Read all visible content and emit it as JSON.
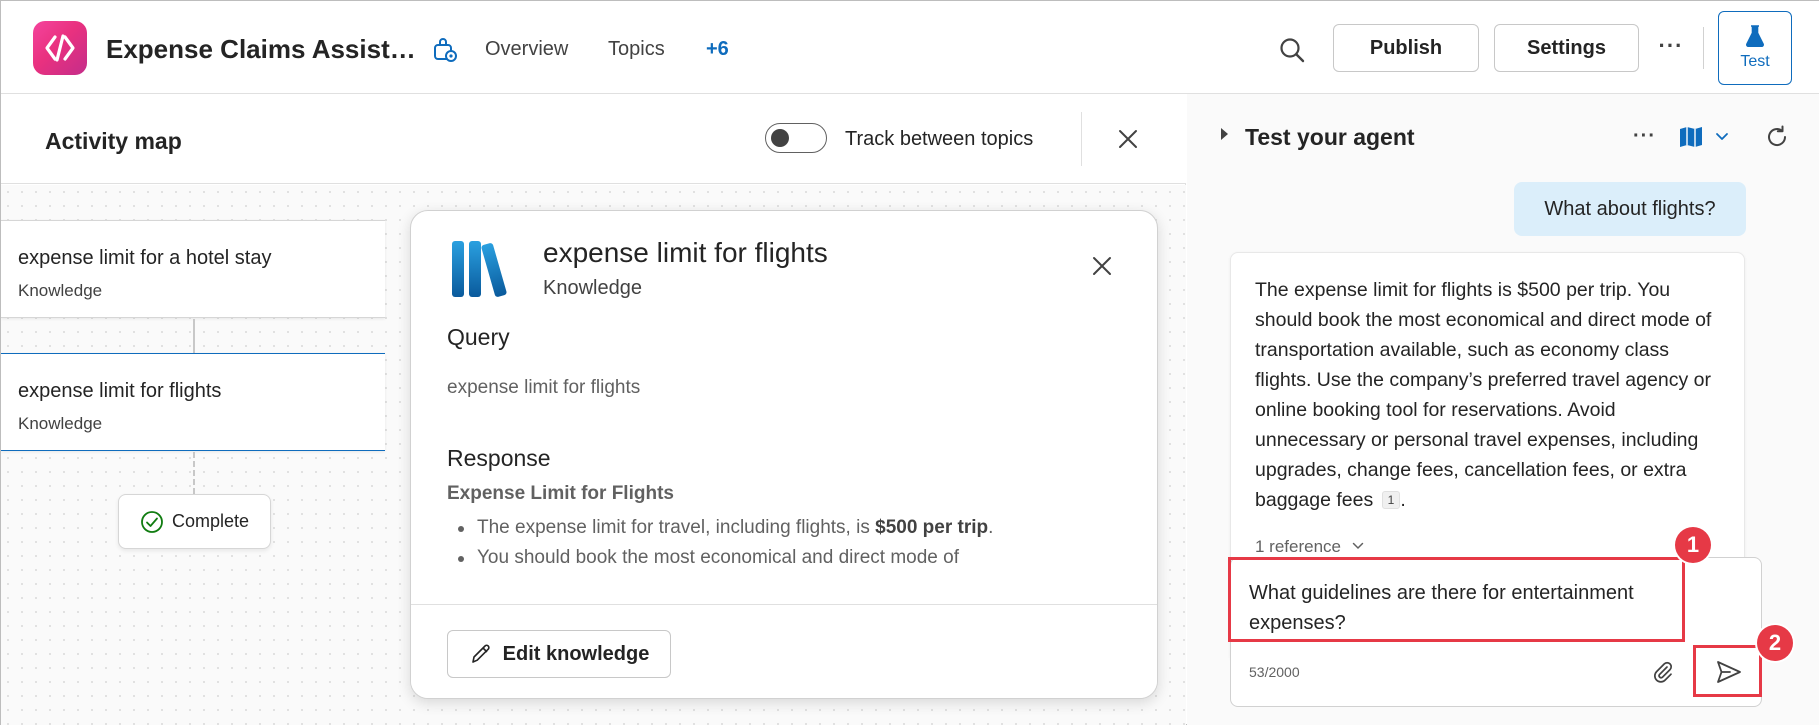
{
  "header": {
    "app_title": "Expense Claims Assist…",
    "nav": [
      "Overview",
      "Topics",
      "+6"
    ],
    "publish_label": "Publish",
    "settings_label": "Settings",
    "more_label": "···",
    "test_label": "Test"
  },
  "activity_map": {
    "title": "Activity map",
    "toggle_label": "Track between topics",
    "nodes": [
      {
        "title": "expense limit for a hotel stay",
        "type": "Knowledge"
      },
      {
        "title": "expense limit for flights",
        "type": "Knowledge"
      }
    ],
    "complete_label": "Complete"
  },
  "detail": {
    "title": "expense limit for flights",
    "subtitle": "Knowledge",
    "query_heading": "Query",
    "query_text": "expense limit for flights",
    "response_heading": "Response",
    "response_title": "Expense Limit for Flights",
    "bullet1_prefix": "The expense limit for travel, including flights, is ",
    "bullet1_bold": "$500 per trip",
    "bullet1_suffix": ".",
    "bullet2": "You should book the most economical and direct mode of",
    "edit_label": "Edit knowledge"
  },
  "test_panel": {
    "title": "Test your agent",
    "more_label": "···",
    "user_message": "What about flights?",
    "bot_message": "The expense limit for flights is $500 per trip. You should book the most economical and direct mode of transportation available, such as economy class flights. Use the company’s preferred travel agency or online booking tool for reservations. Avoid unnecessary or personal travel expenses, including upgrades, change fees, cancellation fees, or extra baggage fees",
    "ref_badge": "1",
    "bot_message_end": ".",
    "reference_toggle": "1 reference",
    "compose_value": "What guidelines are there for entertainment expenses?",
    "char_count": "53/2000"
  },
  "annotations": {
    "step1": "1",
    "step2": "2",
    "color": "#e63946"
  },
  "colors": {
    "accent": "#0f6cbd",
    "user_bubble": "#dbeefa",
    "logo": "#e9317f"
  }
}
